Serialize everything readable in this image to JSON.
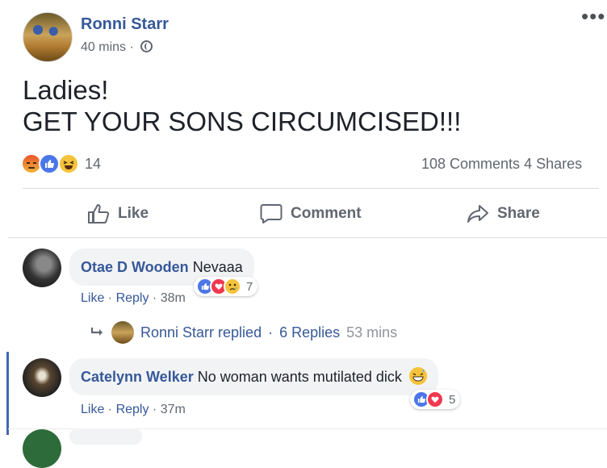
{
  "post": {
    "author": "Ronni Starr",
    "time": "40 mins",
    "time_sep": "·",
    "text_line1": "Ladies!",
    "text_line2": "GET YOUR SONS CIRCUMCISED!!!",
    "more": "•••",
    "reaction_count": "14",
    "comments": "108 Comments",
    "shares": "4 Shares",
    "reactions": [
      "angry-icon",
      "like-icon",
      "haha-icon"
    ]
  },
  "actions": {
    "like": "Like",
    "comment": "Comment",
    "share": "Share"
  },
  "comments": [
    {
      "author": "Otae D Wooden",
      "text": "Nevaaa",
      "like": "Like",
      "reply": "Reply",
      "time": "38m",
      "reaction_count": "7",
      "replies": {
        "replier": "Ronni Starr replied",
        "sep": "·",
        "count": "6 Replies",
        "time": "53 mins"
      }
    },
    {
      "author": "Catelynn Welker",
      "text": "No woman wants mutilated dick",
      "like": "Like",
      "reply": "Reply",
      "time": "37m",
      "reaction_count": "5"
    }
  ],
  "colors": {
    "link": "#365899",
    "like_blue": "#4a76e8",
    "love_red": "#f0384e",
    "haha_yellow": "#f5c33b"
  }
}
